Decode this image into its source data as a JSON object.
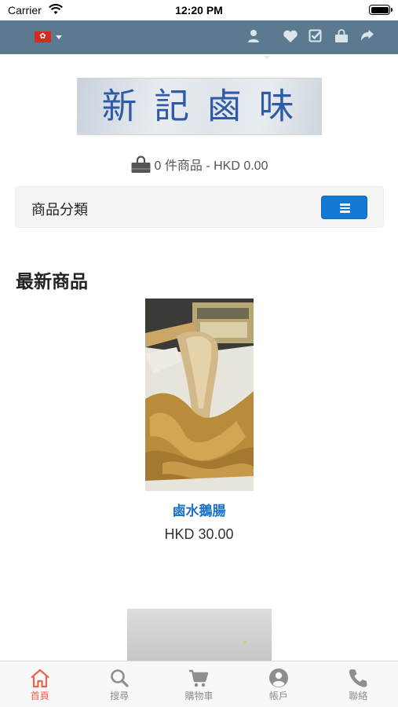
{
  "status_bar": {
    "carrier": "Carrier",
    "time": "12:20 PM"
  },
  "top_nav": {
    "language_flag": "hong-kong-flag",
    "icons": [
      "user-icon",
      "heart-icon",
      "checkbox-icon",
      "shopping-bag-icon",
      "share-icon"
    ]
  },
  "logo": {
    "text": "新 記 鹵 味"
  },
  "cart_summary": {
    "text": "0 件商品 - HKD 0.00"
  },
  "category": {
    "label": "商品分類"
  },
  "section": {
    "title": "最新商品"
  },
  "products": [
    {
      "name": "鹵水鵝腸",
      "price": "HKD 30.00"
    }
  ],
  "tabs": [
    {
      "label": "首頁",
      "icon": "home-icon",
      "active": true
    },
    {
      "label": "搜尋",
      "icon": "search-icon",
      "active": false
    },
    {
      "label": "購物車",
      "icon": "cart-icon",
      "active": false
    },
    {
      "label": "帳戶",
      "icon": "account-icon",
      "active": false
    },
    {
      "label": "聯絡",
      "icon": "phone-icon",
      "active": false
    }
  ],
  "colors": {
    "nav_background": "#5b7a8f",
    "accent_blue": "#1479d4",
    "active_tab": "#e8644a",
    "inactive_tab": "#8e8e8e"
  }
}
